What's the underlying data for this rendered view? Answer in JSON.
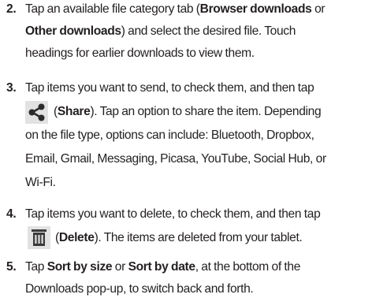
{
  "steps": [
    {
      "number": "2.",
      "lines": [
        {
          "a": "Tap an available file category tab (",
          "b": "Browser downloads",
          "c": " or"
        },
        {
          "a": "",
          "b": "Other downloads",
          "c": ") and select the desired file. Touch"
        },
        {
          "a": "headings for earlier downloads to view them.",
          "b": "",
          "c": ""
        }
      ]
    },
    {
      "number": "3.",
      "lines": [
        {
          "a": "Tap items you want to send, to check them, and then tap",
          "b": "",
          "c": ""
        },
        {
          "a": "(",
          "b": "Share",
          "c": "). Tap an option to share the item. Depending"
        },
        {
          "a": "on the file type, options can include: Bluetooth, Dropbox,",
          "b": "",
          "c": ""
        },
        {
          "a": "Email, Gmail, Messaging, Picasa, YouTube, Social Hub, or",
          "b": "",
          "c": ""
        },
        {
          "a": "Wi-Fi.",
          "b": "",
          "c": ""
        }
      ],
      "icon": "share-icon"
    },
    {
      "number": "4.",
      "lines": [
        {
          "a": "Tap items you want to delete, to check them, and then tap",
          "b": "",
          "c": ""
        },
        {
          "a": "(",
          "b": "Delete",
          "c": "). The items are deleted from your tablet."
        }
      ],
      "icon": "delete-icon"
    },
    {
      "number": "5.",
      "lines": [
        {
          "a": "Tap ",
          "b": "Sort by size",
          "c": " or "
        },
        {
          "a": "Downloads pop-up, to switch back and forth.",
          "b": "",
          "c": ""
        }
      ],
      "extra": {
        "bold2": "Sort by date",
        "tail": ", at the bottom of the"
      }
    }
  ],
  "colors": {
    "text": "#231f20",
    "icon_tile": "#e2e2e2",
    "share_icon": "#2b2b2b",
    "delete_icon": "#3a3a3a"
  }
}
